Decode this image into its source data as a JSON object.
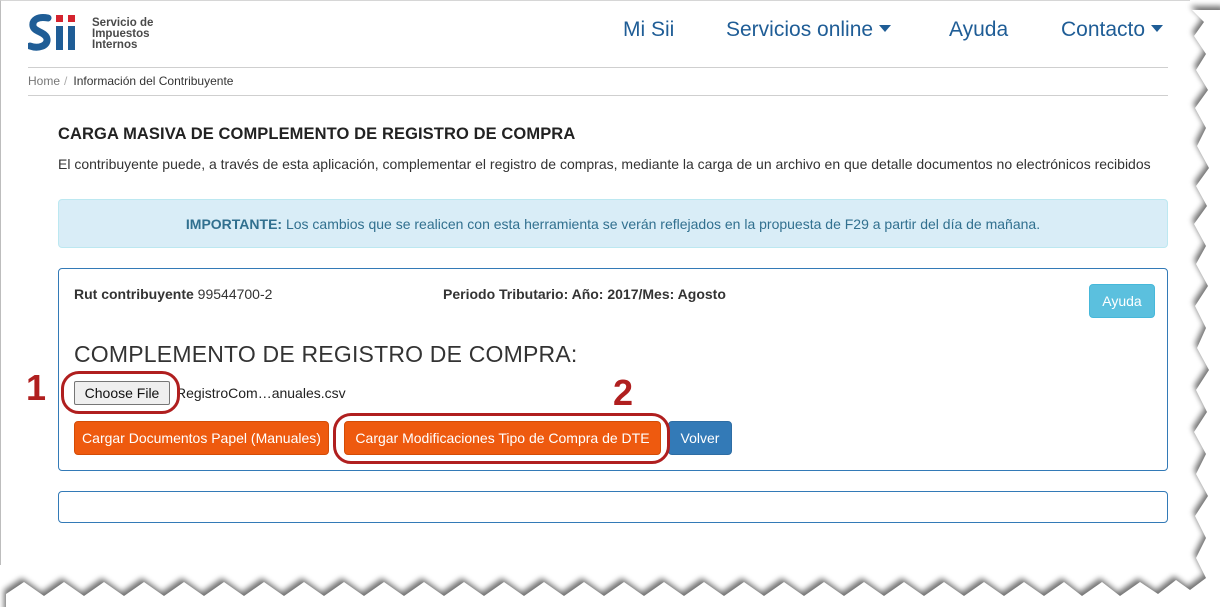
{
  "header": {
    "logo_lines": [
      "Servicio de",
      "Impuestos",
      "Internos"
    ],
    "logo_mark": "Sii",
    "nav": {
      "mi_sii": "Mi Sii",
      "servicios_online": "Servicios online",
      "ayuda": "Ayuda",
      "contacto": "Contacto"
    }
  },
  "breadcrumb": {
    "home": "Home",
    "separator": "/",
    "current": "Información del Contribuyente"
  },
  "main": {
    "title": "CARGA MASIVA DE COMPLEMENTO DE REGISTRO DE COMPRA",
    "description": "El contribuyente puede, a través de esta aplicación, complementar el registro de compras, mediante la carga de un archivo en que detalle documentos no electrónicos recibidos",
    "alert": {
      "label": "IMPORTANTE:",
      "text": " Los cambios que se realicen con esta herramienta se verán reflejados en la propuesta de F29 a partir del día de mañana."
    }
  },
  "panel": {
    "rut_label": "Rut contribuyente",
    "rut_value": " 99544700-2",
    "periodo": "Periodo Tributario: Año: 2017/Mes: Agosto",
    "ayuda_button": "Ayuda",
    "section_title": "COMPLEMENTO DE REGISTRO DE COMPRA:",
    "file_button": "Choose File",
    "file_name": "RegistroCom…anuales.csv",
    "buttons": {
      "cargar_papel": "Cargar Documentos Papel (Manuales)",
      "cargar_modificaciones": "Cargar Modificaciones Tipo de Compra de DTE",
      "volver": "Volver"
    }
  },
  "annotations": {
    "one": "1",
    "two": "2"
  },
  "colors": {
    "brand_blue": "#1f5d96",
    "orange_button": "#ee5a0f",
    "info_button": "#5bc0de",
    "annotation_red": "#b01f1f"
  }
}
